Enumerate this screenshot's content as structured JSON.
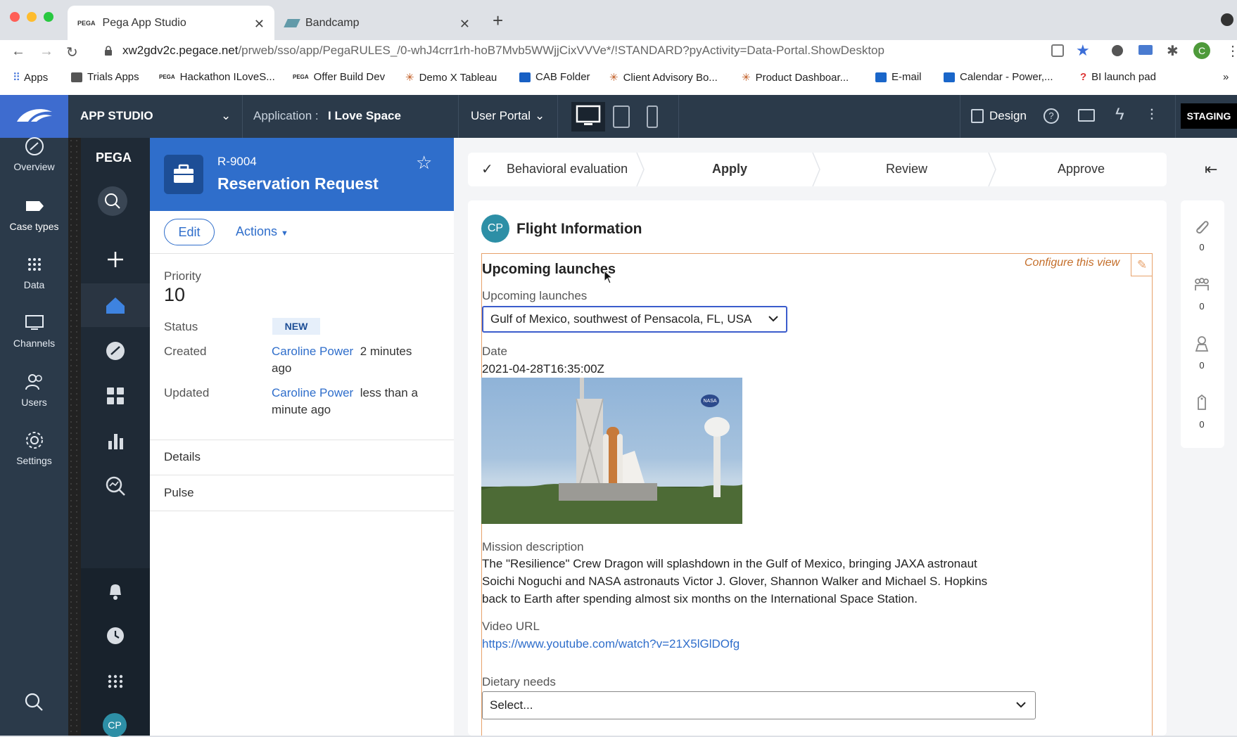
{
  "browser": {
    "tabs": [
      {
        "title": "Pega App Studio",
        "active": true
      },
      {
        "title": "Bandcamp",
        "active": false
      }
    ],
    "url_host": "xw2gdv2c.pegace.net",
    "url_path": "/prweb/sso/app/PegaRULES_/0-whJ4crr1rh-hoB7Mvb5WWjjCixVVVe*/!STANDARD?pyActivity=Data-Portal.ShowDesktop",
    "profile_initial": "C",
    "bookmarks": [
      "Apps",
      "Trials Apps",
      "Hackathon ILoveS...",
      "Offer Build Dev",
      "Demo X Tableau",
      "CAB Folder",
      "Client Advisory Bo...",
      "Product Dashboar...",
      "E-mail",
      "Calendar - Power,...",
      "BI launch pad"
    ],
    "bookmarks_more": "»"
  },
  "header": {
    "studio": "APP STUDIO",
    "application_label": "Application :",
    "application_name": "I Love Space",
    "portal": "User Portal",
    "design": "Design",
    "env": "STAGING"
  },
  "studio_nav": [
    {
      "label": "Overview",
      "icon": "gauge-icon"
    },
    {
      "label": "Case types",
      "icon": "case-type-icon",
      "active": true
    },
    {
      "label": "Data",
      "icon": "grid-dots-icon"
    },
    {
      "label": "Channels",
      "icon": "channels-icon"
    },
    {
      "label": "Users",
      "icon": "users-icon"
    },
    {
      "label": "Settings",
      "icon": "gear-icon"
    }
  ],
  "portal": {
    "brand": "PEGA",
    "user_initials": "CP"
  },
  "case": {
    "id": "R-9004",
    "title": "Reservation Request",
    "edit": "Edit",
    "actions": "Actions",
    "priority_label": "Priority",
    "priority": "10",
    "status_label": "Status",
    "status": "NEW",
    "created_label": "Created",
    "created_by": "Caroline Power",
    "created_time_1": "2 minutes",
    "created_time_2": "ago",
    "updated_label": "Updated",
    "updated_by": "Caroline Power",
    "updated_time_1": "less than a",
    "updated_time_2": "minute ago",
    "tab_details": "Details",
    "tab_pulse": "Pulse"
  },
  "stages": [
    "Behavioral evaluation",
    "Apply",
    "Review",
    "Approve"
  ],
  "form": {
    "avatar": "CP",
    "title": "Flight Information",
    "configure": "Configure this view",
    "section_title": "Upcoming launches",
    "launch_label": "Upcoming launches",
    "launch_value": "Gulf of Mexico, southwest of Pensacola, FL, USA",
    "date_label": "Date",
    "date_value": "2021-04-28T16:35:00Z",
    "image_badge": "NASA",
    "mission_label": "Mission description",
    "mission_line1": "The \"Resilience\" Crew Dragon will splashdown in the Gulf of Mexico, bringing JAXA astronaut",
    "mission_line2": "Soichi Noguchi and NASA astronauts Victor J. Glover, Shannon Walker and Michael S. Hopkins",
    "mission_line3": "back to Earth after spending almost six months on the International Space Station.",
    "video_label": "Video URL",
    "video_url": "https://www.youtube.com/watch?v=21X5lGlDOfg",
    "dietary_label": "Dietary needs",
    "dietary_value": "Select..."
  },
  "side_counts": [
    "0",
    "0",
    "0",
    "0"
  ]
}
